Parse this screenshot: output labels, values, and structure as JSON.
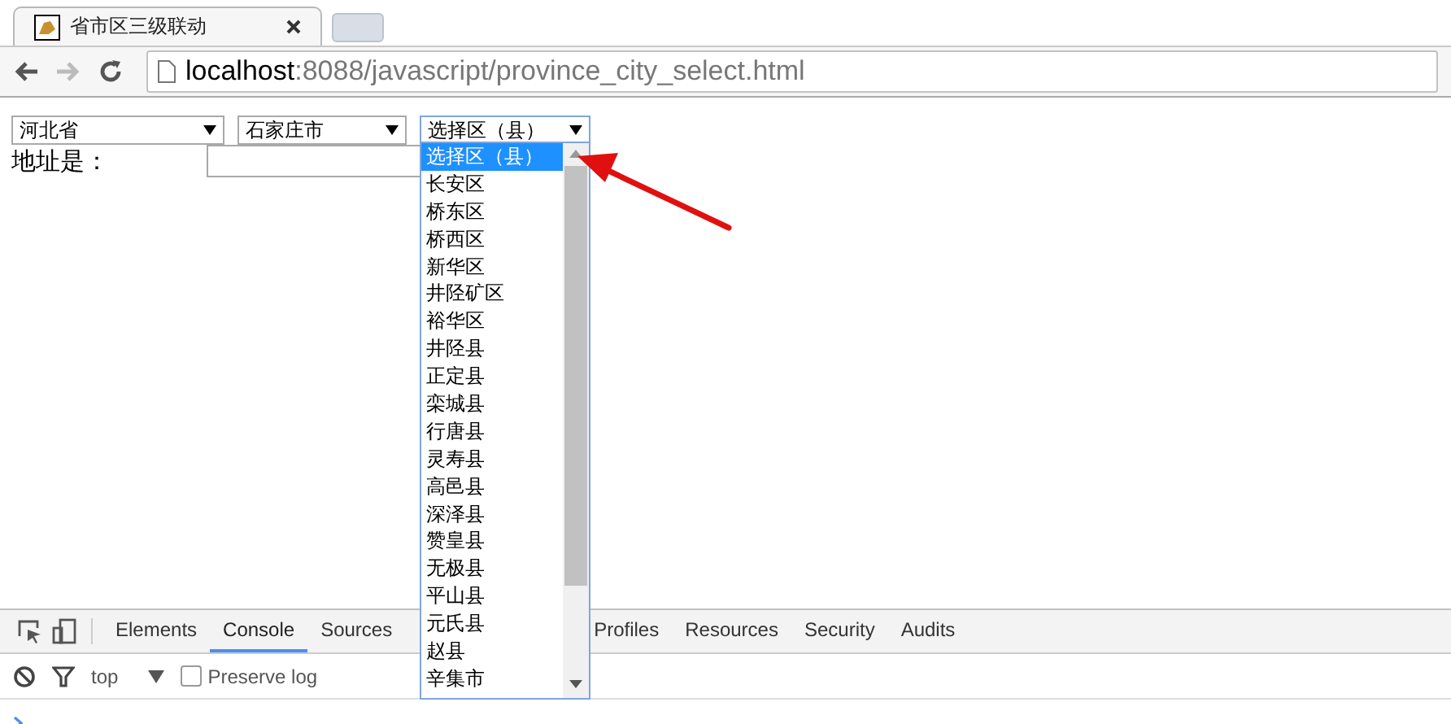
{
  "browser_tab": {
    "title": "省市区三级联动"
  },
  "address_bar": {
    "host": "localhost",
    "path": ":8088/javascript/province_city_select.html"
  },
  "form": {
    "selects": [
      {
        "value": "河北省",
        "expanded": false
      },
      {
        "value": "石家庄市",
        "expanded": false
      },
      {
        "value": "选择区（县）",
        "expanded": true
      }
    ],
    "options": [
      {
        "label": "选择区（县）",
        "selected": true
      },
      {
        "label": "长安区",
        "selected": false
      },
      {
        "label": "桥东区",
        "selected": false
      },
      {
        "label": "桥西区",
        "selected": false
      },
      {
        "label": "新华区",
        "selected": false
      },
      {
        "label": "井陉矿区",
        "selected": false
      },
      {
        "label": "裕华区",
        "selected": false
      },
      {
        "label": "井陉县",
        "selected": false
      },
      {
        "label": "正定县",
        "selected": false
      },
      {
        "label": "栾城县",
        "selected": false
      },
      {
        "label": "行唐县",
        "selected": false
      },
      {
        "label": "灵寿县",
        "selected": false
      },
      {
        "label": "高邑县",
        "selected": false
      },
      {
        "label": "深泽县",
        "selected": false
      },
      {
        "label": "赞皇县",
        "selected": false
      },
      {
        "label": "无极县",
        "selected": false
      },
      {
        "label": "平山县",
        "selected": false
      },
      {
        "label": "元氏县",
        "selected": false
      },
      {
        "label": "赵县",
        "selected": false
      },
      {
        "label": "辛集市",
        "selected": false
      }
    ],
    "address_label": "地址是："
  },
  "devtools": {
    "tabs": [
      {
        "label": "Elements",
        "selected": false
      },
      {
        "label": "Console",
        "selected": true
      },
      {
        "label": "Sources",
        "selected": false
      },
      {
        "label": "Profiles",
        "selected": false
      },
      {
        "label": "Resources",
        "selected": false
      },
      {
        "label": "Security",
        "selected": false
      },
      {
        "label": "Audits",
        "selected": false
      }
    ],
    "context": "top",
    "preserve_log": {
      "label": "Preserve log",
      "checked": false
    }
  }
}
